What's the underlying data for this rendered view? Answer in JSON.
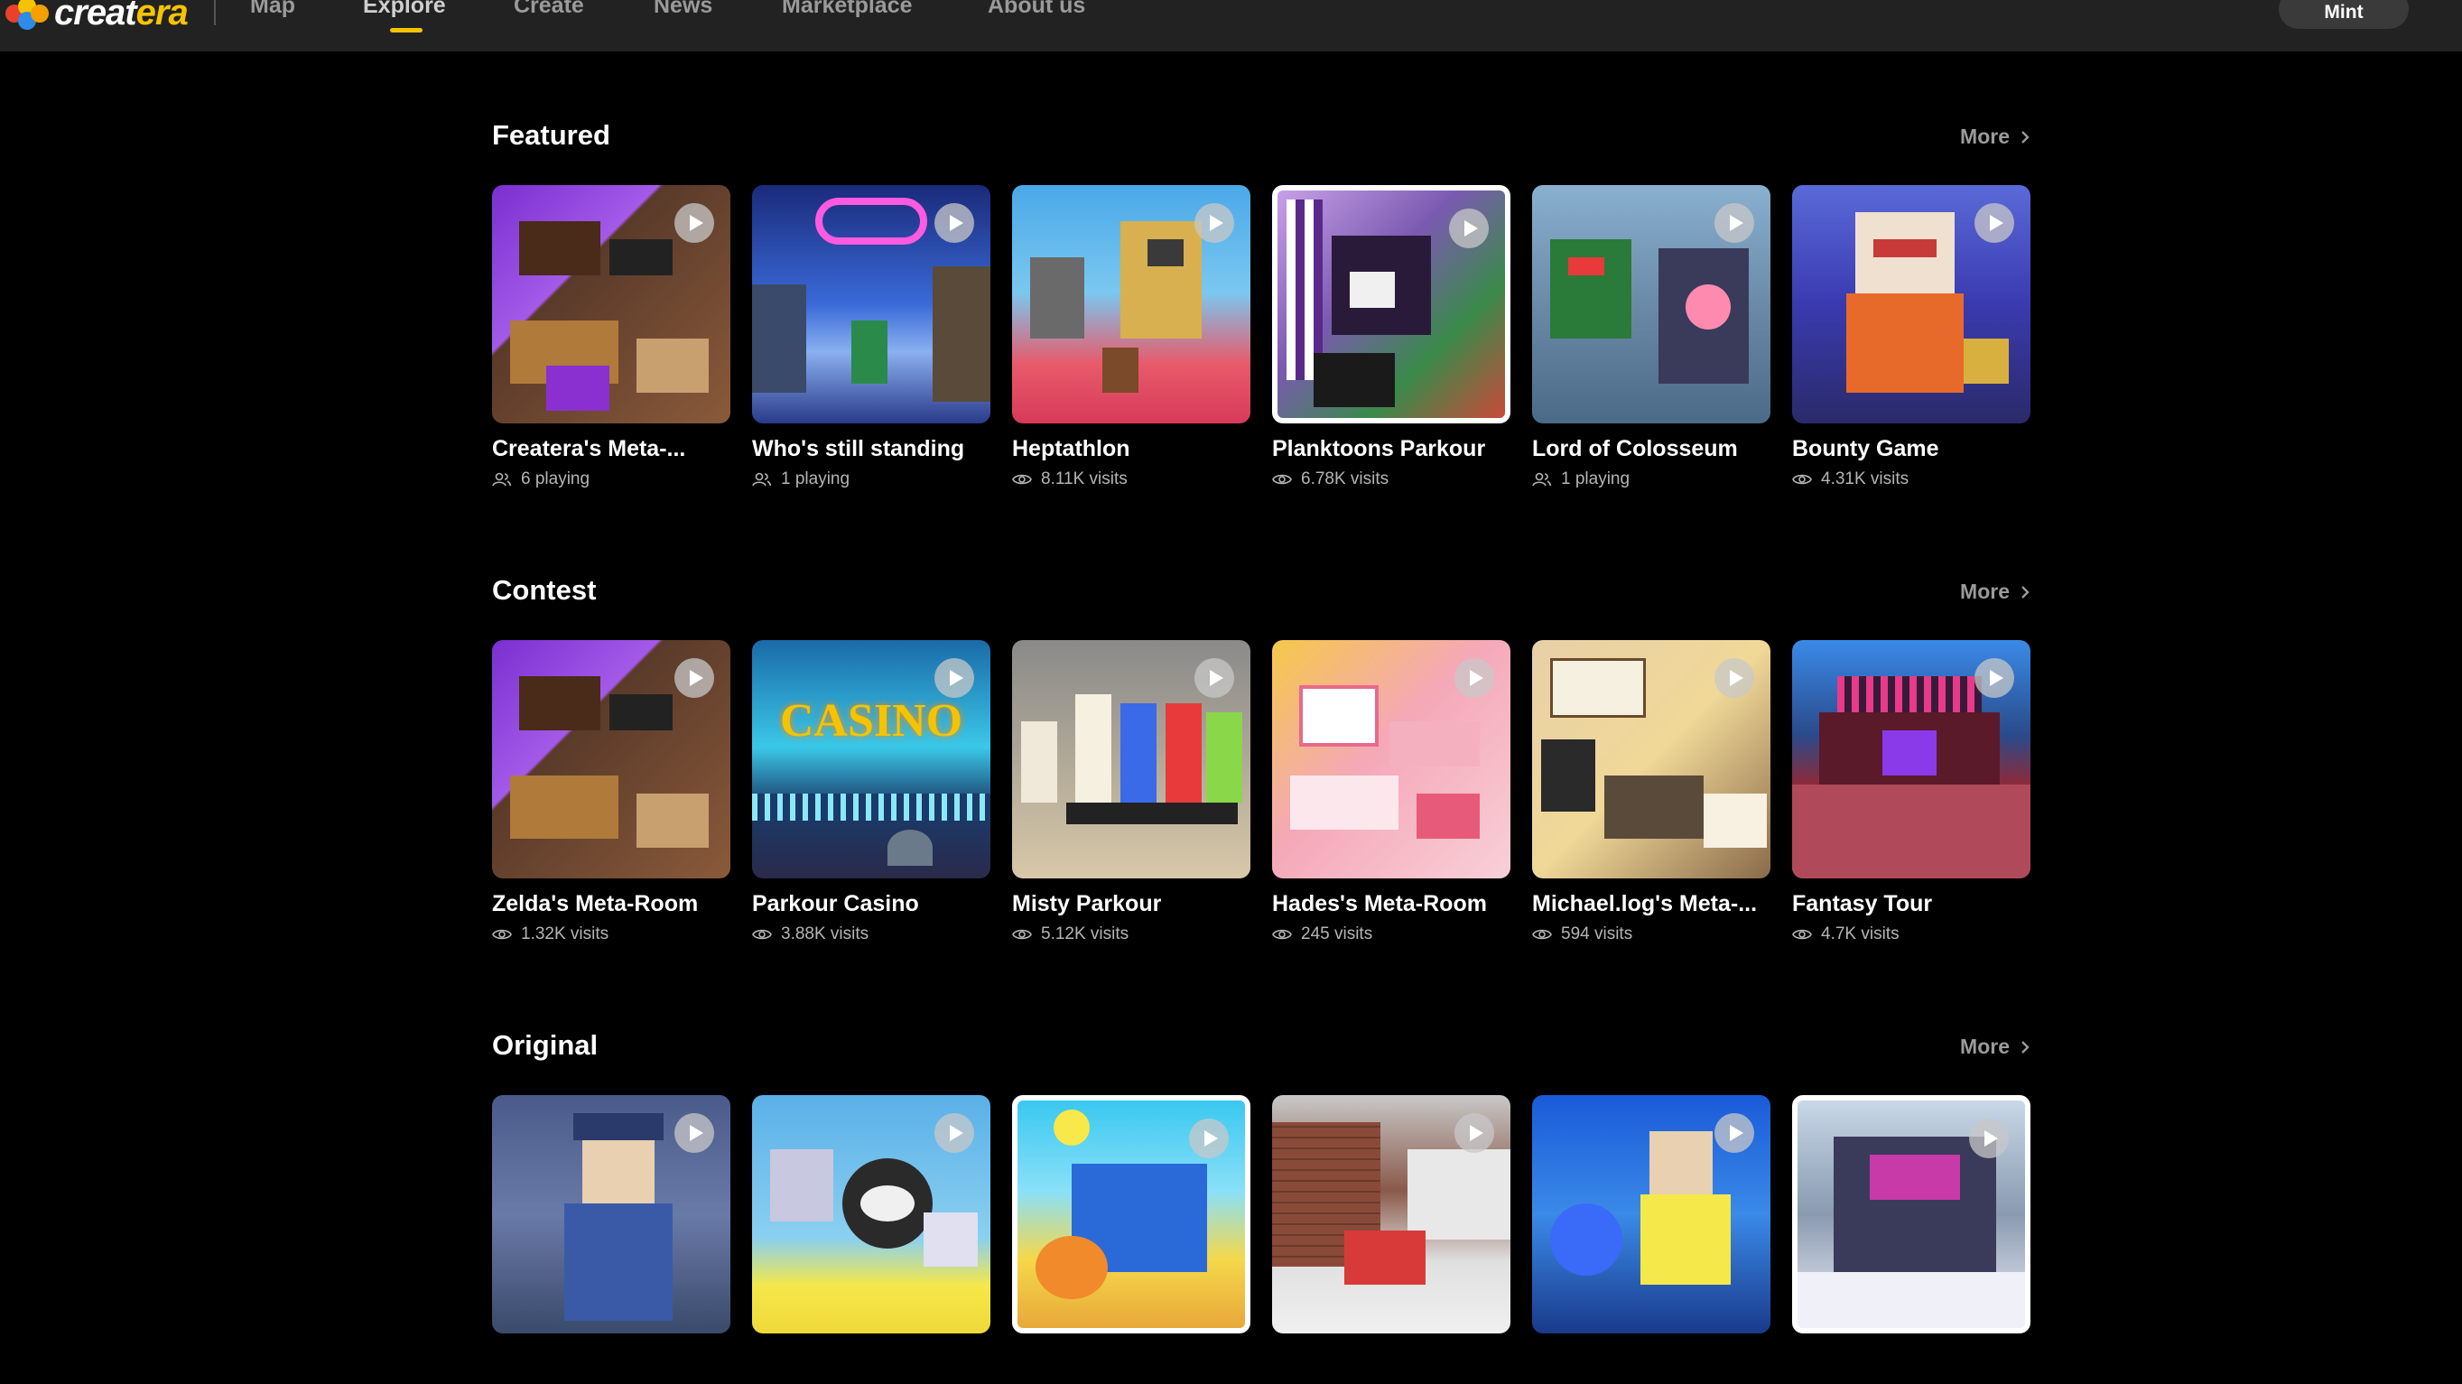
{
  "nav": {
    "logo_prefix": "creat",
    "logo_accent": "era",
    "items": [
      "Map",
      "Explore",
      "Create",
      "News",
      "Marketplace",
      "About us"
    ],
    "active": "Explore",
    "mint_label": "Mint"
  },
  "sections": [
    {
      "title": "Featured",
      "more_label": "More",
      "cards": [
        {
          "title": "Createra's Meta-...",
          "meta": "6 playing",
          "meta_icon": "users-icon"
        },
        {
          "title": "Who's still standing",
          "meta": "1 playing",
          "meta_icon": "users-icon"
        },
        {
          "title": "Heptathlon",
          "meta": "8.11K visits",
          "meta_icon": "eye-icon"
        },
        {
          "title": "Planktoons Parkour",
          "meta": "6.78K visits",
          "meta_icon": "eye-icon"
        },
        {
          "title": "Lord of Colosseum",
          "meta": "1 playing",
          "meta_icon": "users-icon"
        },
        {
          "title": "Bounty Game",
          "meta": "4.31K visits",
          "meta_icon": "eye-icon"
        }
      ]
    },
    {
      "title": "Contest",
      "more_label": "More",
      "cards": [
        {
          "title": "Zelda's Meta-Room",
          "meta": "1.32K visits",
          "meta_icon": "eye-icon"
        },
        {
          "title": "Parkour Casino",
          "meta": "3.88K visits",
          "meta_icon": "eye-icon"
        },
        {
          "title": "Misty Parkour",
          "meta": "5.12K visits",
          "meta_icon": "eye-icon"
        },
        {
          "title": "Hades's Meta-Room",
          "meta": "245 visits",
          "meta_icon": "eye-icon"
        },
        {
          "title": "Michael.log's Meta-...",
          "meta": "594 visits",
          "meta_icon": "eye-icon"
        },
        {
          "title": "Fantasy Tour",
          "meta": "4.7K visits",
          "meta_icon": "eye-icon"
        }
      ]
    },
    {
      "title": "Original",
      "more_label": "More",
      "cards": [
        {
          "title": "",
          "meta": ""
        },
        {
          "title": "",
          "meta": ""
        },
        {
          "title": "",
          "meta": ""
        },
        {
          "title": "",
          "meta": ""
        },
        {
          "title": "",
          "meta": ""
        },
        {
          "title": "",
          "meta": ""
        }
      ]
    }
  ],
  "casino_sign": "CASINO",
  "colors": {
    "accent": "#f5c400",
    "topbar": "#222222",
    "background": "#000000",
    "muted_text": "#9a9a9a"
  }
}
